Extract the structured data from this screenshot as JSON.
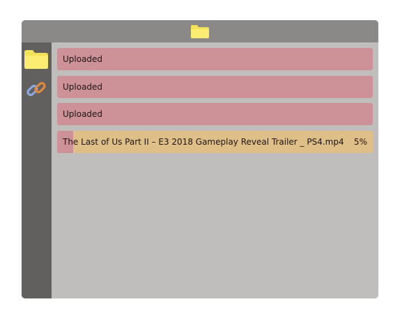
{
  "titlebar": {
    "icon": "folder-icon"
  },
  "sidebar": {
    "items": [
      {
        "icon": "folder-icon"
      },
      {
        "icon": "link-icon"
      }
    ]
  },
  "uploads": [
    {
      "label": "Uploaded",
      "status": "uploaded"
    },
    {
      "label": "Uploaded",
      "status": "uploaded"
    },
    {
      "label": "Uploaded",
      "status": "uploaded"
    },
    {
      "label": "The Last of Us Part II – E3 2018 Gameplay Reveal Trailer _ PS4.mp4",
      "percent_text": "5%",
      "progress": 0.05,
      "status": "uploading"
    }
  ],
  "colors": {
    "titlebar": "#8a8987",
    "sidebar": "#61605e",
    "content": "#bfbebc",
    "uploaded": "#cd9297",
    "uploading": "#dfbf88",
    "folder": "#f5e35a"
  }
}
